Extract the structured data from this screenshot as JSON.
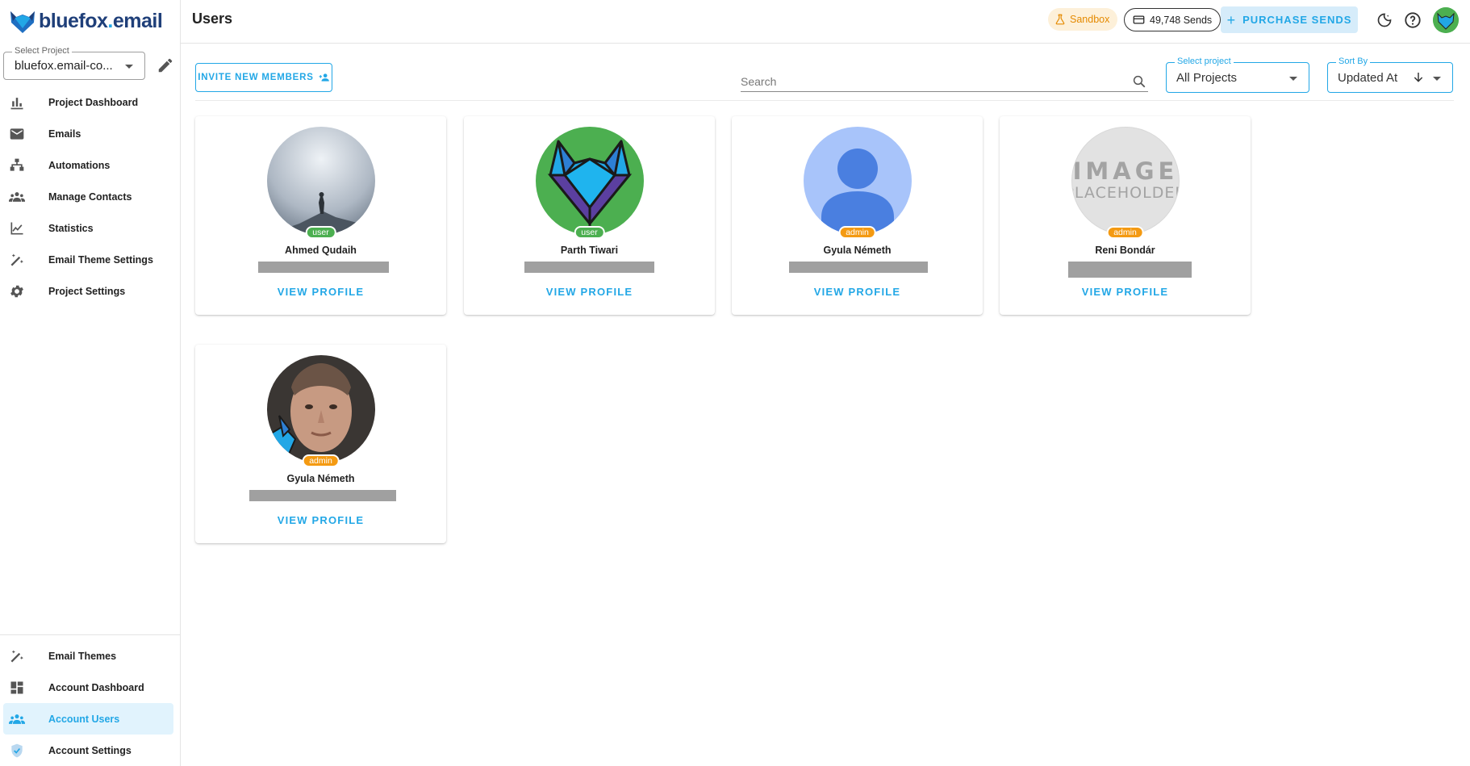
{
  "brand": {
    "name_main": "bluefox",
    "name_dot": ".",
    "name_tld": "email"
  },
  "project_select": {
    "legend": "Select Project",
    "value": "bluefox.email-co..."
  },
  "nav_top": [
    {
      "label": "Project Dashboard",
      "icon": "dashboard-chart-icon"
    },
    {
      "label": "Emails",
      "icon": "mail-icon"
    },
    {
      "label": "Automations",
      "icon": "sitemap-icon"
    },
    {
      "label": "Manage Contacts",
      "icon": "contacts-icon"
    },
    {
      "label": "Statistics",
      "icon": "line-chart-icon"
    },
    {
      "label": "Email Theme Settings",
      "icon": "magic-wand-icon"
    },
    {
      "label": "Project Settings",
      "icon": "gear-icon"
    }
  ],
  "nav_bottom": [
    {
      "label": "Email Themes",
      "icon": "magic-wand-icon"
    },
    {
      "label": "Account Dashboard",
      "icon": "grid-dashboard-icon"
    },
    {
      "label": "Account Users",
      "icon": "users-icon",
      "active": true
    },
    {
      "label": "Account Settings",
      "icon": "shield-icon"
    }
  ],
  "header": {
    "title": "Users",
    "sandbox": "Sandbox",
    "sends": "49,748 Sends",
    "purchase": "PURCHASE SENDS"
  },
  "toolbar": {
    "invite": "INVITE NEW MEMBERS",
    "search_placeholder": "Search",
    "project_filter": {
      "legend": "Select project",
      "value": "All Projects"
    },
    "sort": {
      "legend": "Sort By",
      "value": "Updated At"
    }
  },
  "users": [
    {
      "name": "Ahmed Qudaih",
      "role": "user",
      "avatar": "photo-mountain",
      "view": "VIEW PROFILE"
    },
    {
      "name": "Parth Tiwari",
      "role": "user",
      "avatar": "fox-logo",
      "view": "VIEW PROFILE"
    },
    {
      "name": "Gyula Németh",
      "role": "admin",
      "avatar": "default-person",
      "view": "VIEW PROFILE"
    },
    {
      "name": "Reni Bondár",
      "role": "admin",
      "avatar": "image-placeholder",
      "view": "VIEW PROFILE",
      "placeholder_line1": "IMAGE",
      "placeholder_line2": "PLACEHOLDER"
    },
    {
      "name": "Gyula Németh",
      "role": "admin",
      "avatar": "photo-face",
      "view": "VIEW PROFILE"
    }
  ],
  "colors": {
    "accent": "#22a7e6",
    "user_badge": "#4caf50",
    "admin_badge": "#f49a12",
    "brand_dark": "#1f3f79"
  }
}
